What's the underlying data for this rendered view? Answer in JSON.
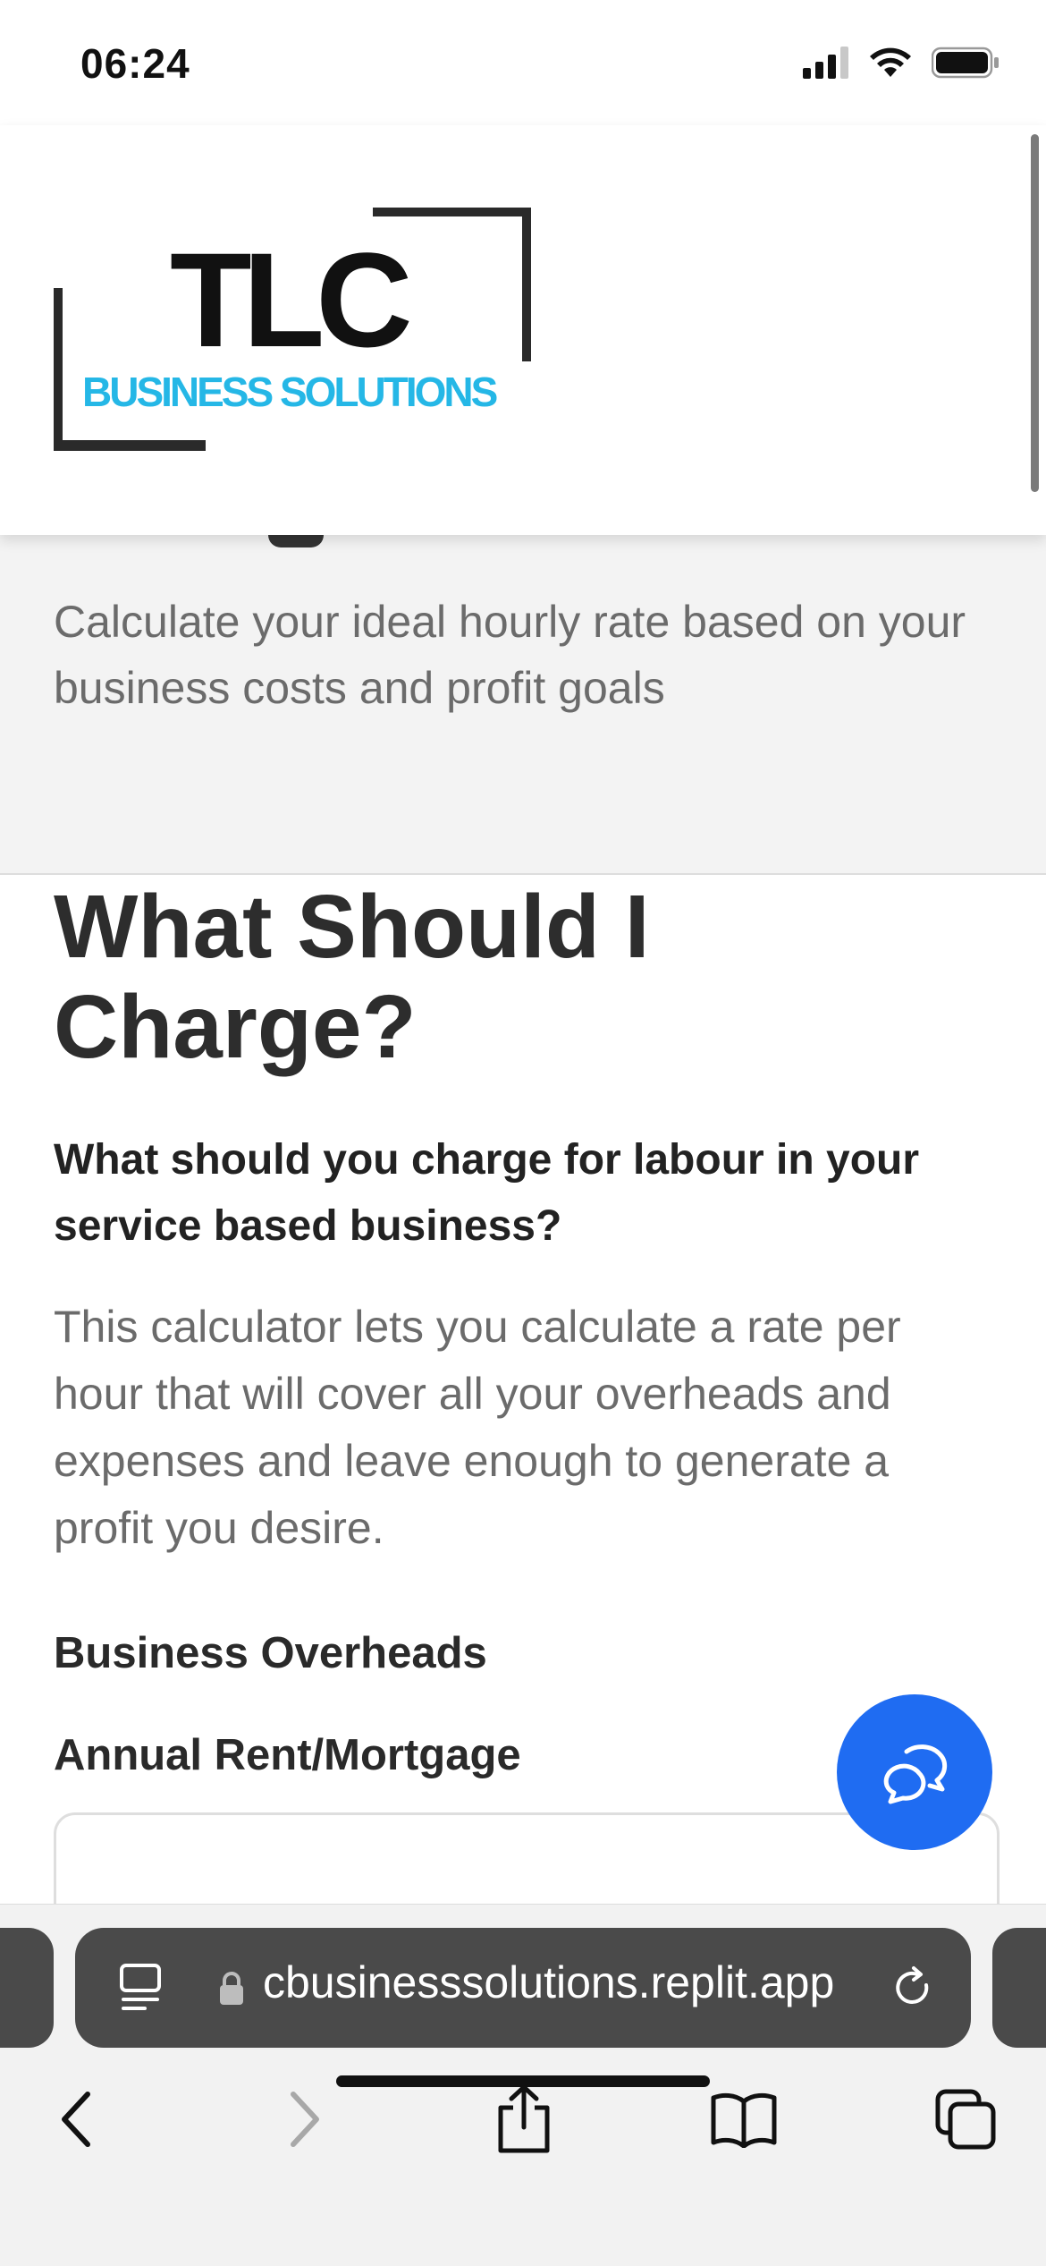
{
  "status_bar": {
    "time": "06:24"
  },
  "header": {
    "logo_title": "TLC",
    "logo_subtitle": "BUSINESS SOLUTIONS"
  },
  "hero": {
    "subtitle": "Calculate your ideal hourly rate based on your business costs and profit goals"
  },
  "main": {
    "title": "What Should I Charge?",
    "sub_heading": "What should you charge for labour in your service based business?",
    "intro": "This calculator lets you calculate a rate per hour that will cover all your overheads and expenses and leave enough to generate a profit you desire.",
    "section_label": "Business Overheads",
    "field_label": "Annual Rent/Mortgage",
    "field_value": ""
  },
  "browser": {
    "url": "cbusinesssolutions.replit.app"
  },
  "colors": {
    "brand_blue": "#1f6cf2",
    "logo_cyan": "#25b7e6",
    "dark_text": "#2d2d2d",
    "muted_text": "#6b6b6b"
  }
}
